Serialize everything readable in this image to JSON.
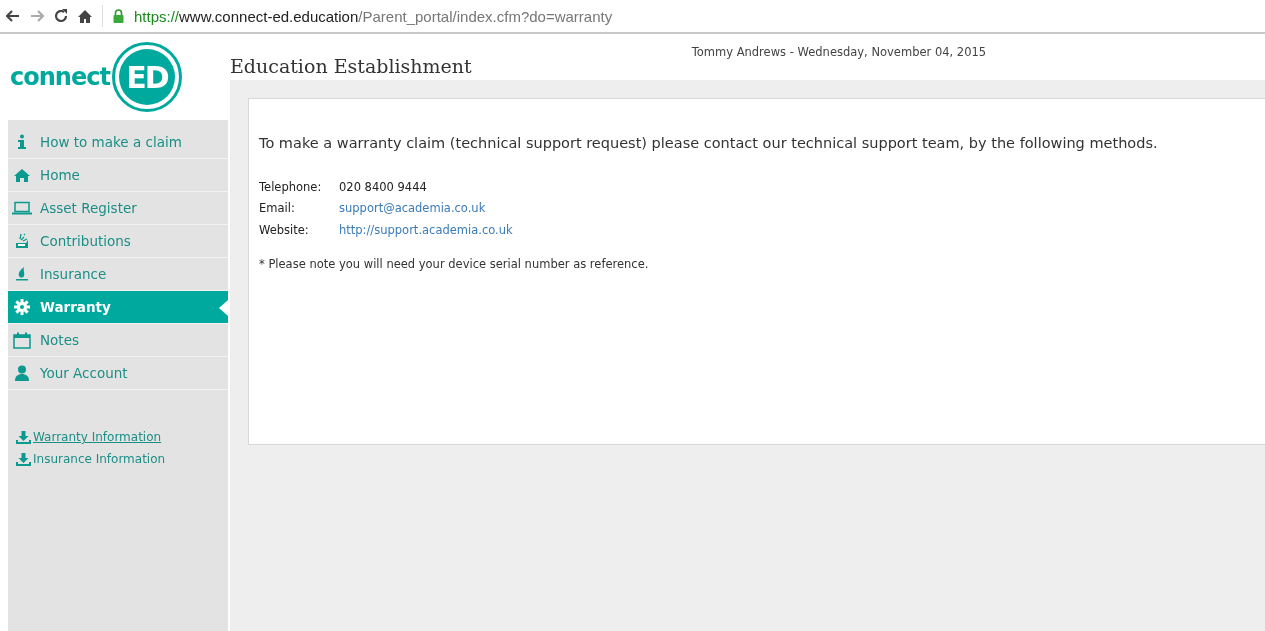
{
  "browser": {
    "url": {
      "scheme": "https://",
      "host": "www.connect-ed.education",
      "path": "/Parent_portal/index.cfm?do=warranty"
    }
  },
  "logo": {
    "word": "connect",
    "mark": "ED"
  },
  "header": {
    "title": "Education Establishment",
    "user_date": "Tommy Andrews - Wednesday, November 04, 2015"
  },
  "sidebar": {
    "items": [
      {
        "label": "How to make a claim",
        "selected": false
      },
      {
        "label": "Home",
        "selected": false
      },
      {
        "label": "Asset Register",
        "selected": false
      },
      {
        "label": "Contributions",
        "selected": false
      },
      {
        "label": "Insurance",
        "selected": false
      },
      {
        "label": "Warranty",
        "selected": true
      },
      {
        "label": "Notes",
        "selected": false
      },
      {
        "label": "Your Account",
        "selected": false
      }
    ],
    "downloads": [
      {
        "label": "Warranty Information",
        "underlined": true
      },
      {
        "label": "Insurance Information",
        "underlined": false
      }
    ]
  },
  "content": {
    "intro": "To make a warranty claim (technical support request) please contact our technical support team, by the following methods.",
    "contacts": [
      {
        "label": "Telephone:",
        "value": "020 8400 9444",
        "kind": "text"
      },
      {
        "label": "Email:",
        "value": "support@academia.co.uk",
        "kind": "link"
      },
      {
        "label": "Website:",
        "value": "http://support.academia.co.uk",
        "kind": "link"
      }
    ],
    "note": "* Please note you will need your device serial number as reference."
  }
}
